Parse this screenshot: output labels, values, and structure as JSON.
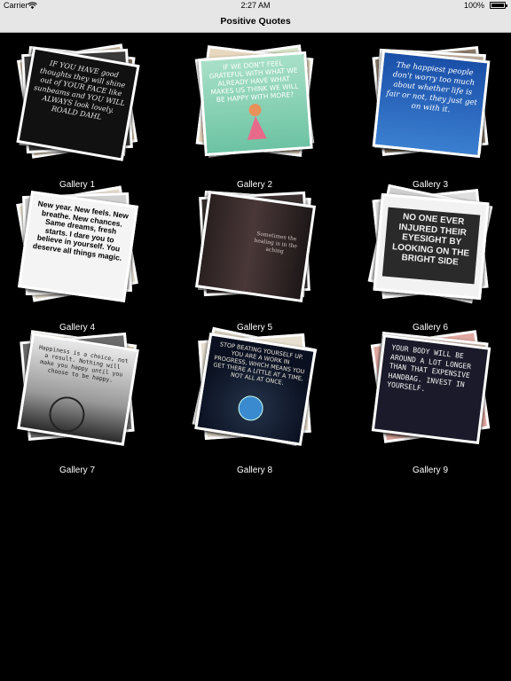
{
  "status_bar": {
    "carrier": "Carrier",
    "time": "2:27 AM",
    "battery": "100%"
  },
  "nav": {
    "title": "Positive Quotes"
  },
  "galleries": [
    {
      "label": "Gallery 1",
      "quote": "IF YOU HAVE good thoughts they will shine out of YOUR FACE like sunbeams and YOU WILL ALWAYS look lovely. ROALD DAHL"
    },
    {
      "label": "Gallery 2",
      "quote": "IF WE DON'T FEEL GRATEFUL WITH WHAT WE ALREADY HAVE WHAT MAKES US THINK WE WILL BE HAPPY WITH MORE?"
    },
    {
      "label": "Gallery 3",
      "quote": "The happiest people don't worry too much about whether life is fair or not, they just get on with it."
    },
    {
      "label": "Gallery 4",
      "quote": "New year. New feels. New breathe. New chances. Same dreams, fresh starts. I dare you to believe in yourself. You deserve all things magic."
    },
    {
      "label": "Gallery 5",
      "quote": "Sometimes the healing is in the aching"
    },
    {
      "label": "Gallery 6",
      "quote": "NO ONE EVER INJURED THEIR EYESIGHT BY LOOKING ON THE BRIGHT SIDE"
    },
    {
      "label": "Gallery 7",
      "quote": "Happiness is a choice, not a result. Nothing will make you happy until you choose to be happy."
    },
    {
      "label": "Gallery 8",
      "quote": "STOP BEATING YOURSELF UP. YOU ARE A WORK IN PROGRESS, WHICH MEANS YOU GET THERE A LITTLE AT A TIME, NOT ALL AT ONCE."
    },
    {
      "label": "Gallery 9",
      "quote": "YOUR BODY WILL BE AROUND A LOT LONGER THAN THAT EXPENSIVE HANDBAG. INVEST IN YOURSELF."
    }
  ]
}
